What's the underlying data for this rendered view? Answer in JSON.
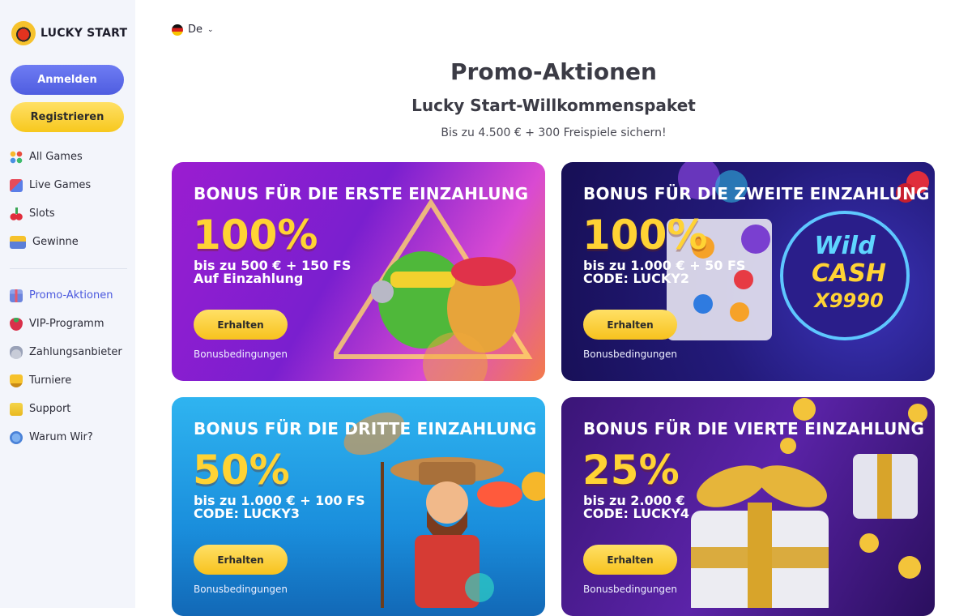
{
  "brand": {
    "name": "LUCKY START"
  },
  "auth": {
    "login": "Anmelden",
    "register": "Registrieren"
  },
  "nav_main": [
    {
      "label": "All Games",
      "icon": "all-games-icon"
    },
    {
      "label": "Live Games",
      "icon": "live-games-icon"
    },
    {
      "label": "Slots",
      "icon": "cherries-icon"
    },
    {
      "label": "Gewinne",
      "icon": "trophy-stand-icon"
    }
  ],
  "nav_secondary": [
    {
      "label": "Promo-Aktionen",
      "icon": "gift-icon",
      "active": true
    },
    {
      "label": "VIP-Programm",
      "icon": "strawberry-icon"
    },
    {
      "label": "Zahlungsanbieter",
      "icon": "money-bag-icon"
    },
    {
      "label": "Turniere",
      "icon": "trophy-icon"
    },
    {
      "label": "Support",
      "icon": "support-chat-icon"
    },
    {
      "label": "Warum Wir?",
      "icon": "question-icon"
    }
  ],
  "language": {
    "current": "De"
  },
  "page": {
    "title": "Promo-Aktionen",
    "subtitle": "Lucky Start-Willkommenspaket",
    "tagline": "Bis zu 4.500 € + 300 Freispiele sichern!"
  },
  "cards": [
    {
      "title": "BONUS FÜR DIE ERSTE EINZAHLUNG",
      "percent": "100%",
      "line1": "bis zu 500 € + 150 FS",
      "line2": "Auf Einzahlung",
      "button": "Erhalten",
      "terms": "Bonusbedingungen"
    },
    {
      "title": "BONUS FÜR DIE ZWEITE EINZAHLUNG",
      "percent": "100%",
      "line1": "bis zu 1.000 € + 50 FS",
      "line2": "CODE: LUCKY2",
      "button": "Erhalten",
      "terms": "Bonusbedingungen",
      "art_text": "Wild",
      "art_text2": "CASH",
      "art_text3": "X9990"
    },
    {
      "title": "BONUS FÜR DIE DRITTE EINZAHLUNG",
      "percent": "50%",
      "line1": "bis zu 1.000 € + 100 FS",
      "line2": "CODE: LUCKY3",
      "button": "Erhalten",
      "terms": "Bonusbedingungen"
    },
    {
      "title": "BONUS FÜR DIE VIERTE EINZAHLUNG",
      "percent": "25%",
      "line1": "bis zu 2.000 €",
      "line2": "CODE: LUCKY4",
      "button": "Erhalten",
      "terms": "Bonusbedingungen"
    }
  ],
  "colors": {
    "accent": "#4f5de0",
    "cta": "#f7c81d",
    "bonus_percent": "#ffd334"
  }
}
